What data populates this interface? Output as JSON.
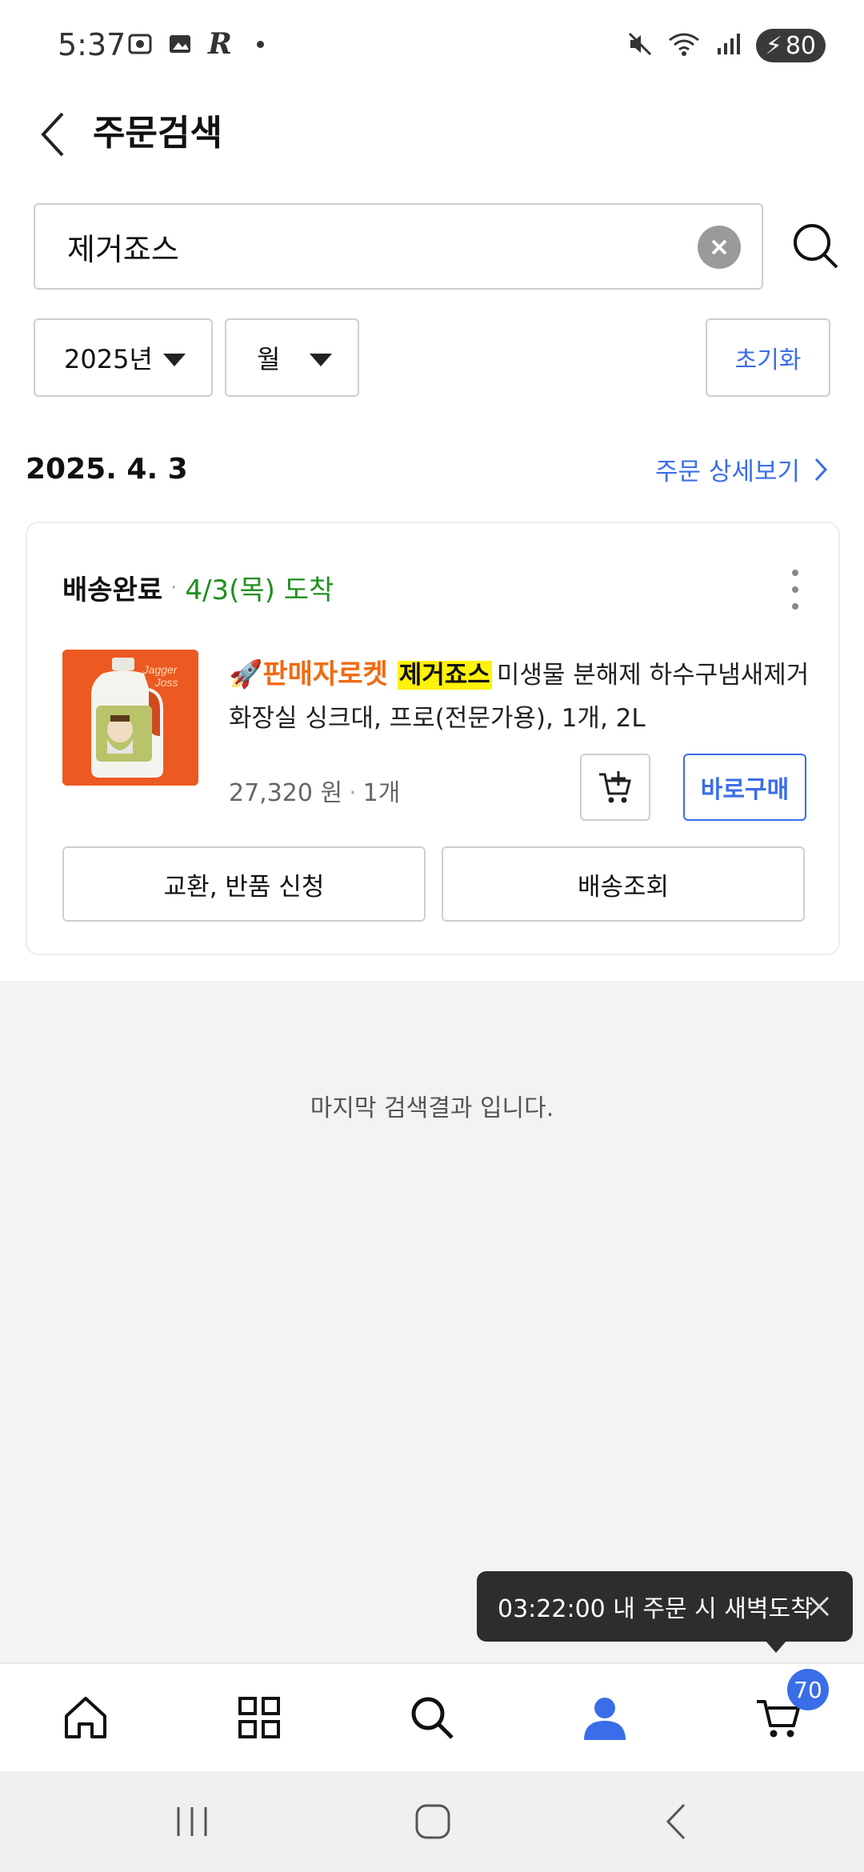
{
  "status_bar": {
    "time": "5:37",
    "battery": "80"
  },
  "header": {
    "title": "주문검색"
  },
  "search": {
    "value": "제거죠스"
  },
  "filters": {
    "year": "2025년",
    "month": "월",
    "reset_label": "초기화"
  },
  "order": {
    "date": "2025. 4. 3",
    "detail_link": "주문 상세보기",
    "status": "배송완료",
    "arrival": "4/3(목) 도착",
    "product": {
      "badge": "🚀판매자로켓",
      "highlight": "제거죠스",
      "title_rest": "미생물 분해제 하수구냄새제거 화장실 싱크대, 프로(전문가용), 1개, 2L",
      "price": "27,320 원",
      "quantity": "1개",
      "buy_now_label": "바로구매"
    },
    "exchange_return_label": "교환, 반품 신청",
    "tracking_label": "배송조회"
  },
  "end_message": "마지막 검색결과 입니다.",
  "toast": {
    "text": "03:22:00 내 주문 시 새벽도착"
  },
  "bottom_nav": {
    "cart_count": "70"
  },
  "colors": {
    "accent": "#3a6ee8",
    "arrival_green": "#1f8f1f",
    "rocket_orange": "#f06a14",
    "highlight_yellow": "#fff20a"
  }
}
